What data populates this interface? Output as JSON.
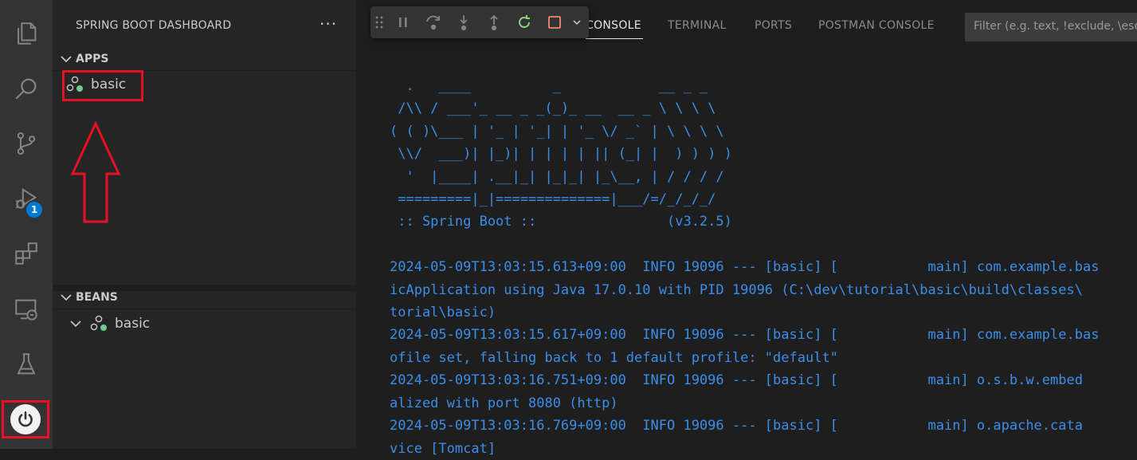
{
  "activity_bar": {
    "debug_badge": "1"
  },
  "sidebar": {
    "title": "SPRING BOOT DASHBOARD",
    "more": "···",
    "apps_section": {
      "label": "APPS",
      "items": [
        {
          "label": "basic"
        }
      ]
    },
    "beans_section": {
      "label": "BEANS",
      "items": [
        {
          "label": "basic"
        }
      ]
    }
  },
  "panel": {
    "tabs": [
      {
        "label": "CONSOLE",
        "active": true
      },
      {
        "label": "TERMINAL"
      },
      {
        "label": "PORTS"
      },
      {
        "label": "POSTMAN CONSOLE"
      }
    ],
    "filter_placeholder": "Filter (e.g. text, !exclude, \\escape)",
    "console_lines": [
      "  .   ____          _            __ _ _",
      " /\\\\ / ___'_ __ _ _(_)_ __  __ _ \\ \\ \\ \\",
      "( ( )\\___ | '_ | '_| | '_ \\/ _` | \\ \\ \\ \\",
      " \\\\/  ___)| |_)| | | | | || (_| |  ) ) ) )",
      "  '  |____| .__|_| |_|_| |_\\__, | / / / /",
      " =========|_|==============|___/=/_/_/_/",
      " :: Spring Boot ::                (v3.2.5)",
      "",
      "2024-05-09T13:03:15.613+09:00  INFO 19096 --- [basic] [           main] com.example.bas",
      "icApplication using Java 17.0.10 with PID 19096 (C:\\dev\\tutorial\\basic\\build\\classes\\",
      "torial\\basic)",
      "2024-05-09T13:03:15.617+09:00  INFO 19096 --- [basic] [           main] com.example.bas",
      "ofile set, falling back to 1 default profile: \"default\"",
      "2024-05-09T13:03:16.751+09:00  INFO 19096 --- [basic] [           main] o.s.b.w.embed",
      "alized with port 8080 (http)",
      "2024-05-09T13:03:16.769+09:00  INFO 19096 --- [basic] [           main] o.apache.cata",
      "vice [Tomcat]"
    ]
  },
  "colors": {
    "activity_bg": "#333333",
    "sidebar_bg": "#252526",
    "panel_bg": "#1e1e1e",
    "console_text": "#3b8eea",
    "annotation_red": "#e81123",
    "running_green": "#73c991"
  }
}
